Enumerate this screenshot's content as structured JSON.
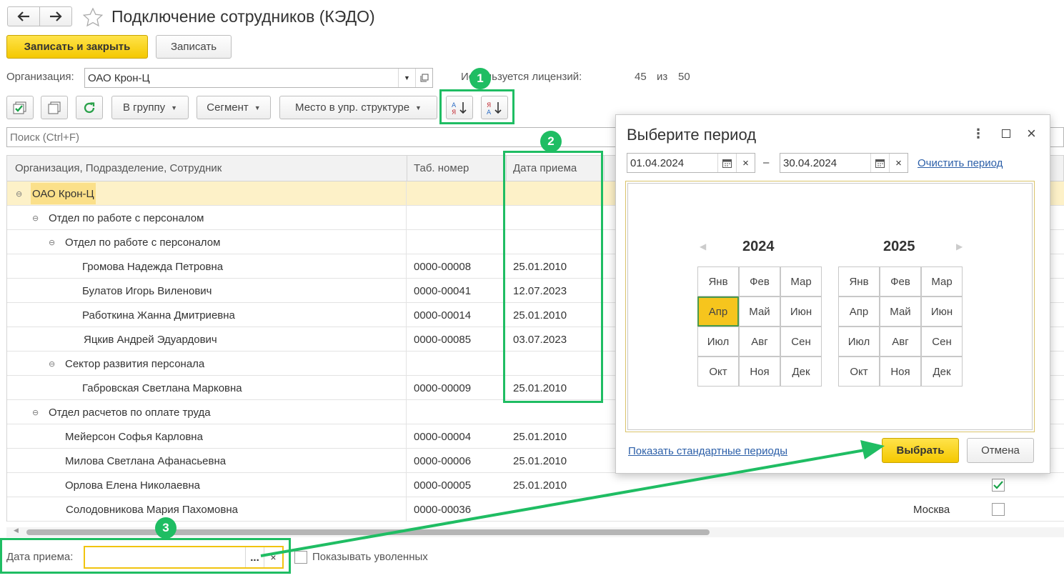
{
  "window": {
    "title": "Подключение сотрудников (КЭДО)"
  },
  "toolbar": {
    "save_close": "Записать и закрыть",
    "save": "Записать"
  },
  "org": {
    "label": "Организация:",
    "value": "ОАО Крон-Ц",
    "licenses_label": "Используется лицензий:",
    "used": "45",
    "of": "из",
    "total": "50"
  },
  "filters": {
    "group": "В группу",
    "segment": "Сегмент",
    "place": "Место в упр. структуре"
  },
  "search": {
    "placeholder": "Поиск (Ctrl+F)"
  },
  "table": {
    "headers": [
      "Организация, Подразделение, Сотрудник",
      "Таб. номер",
      "Дата приема"
    ],
    "rows": [
      {
        "name": "ОАО Крон-Ц",
        "tab": "",
        "date": ""
      },
      {
        "name": "Отдел по работе с персоналом",
        "tab": "",
        "date": ""
      },
      {
        "name": "Отдел по работе с персоналом",
        "tab": "",
        "date": ""
      },
      {
        "name": "Громова Надежда Петровна",
        "tab": "0000-00008",
        "date": "25.01.2010"
      },
      {
        "name": "Булатов Игорь Виленович",
        "tab": "0000-00041",
        "date": "12.07.2023"
      },
      {
        "name": "Работкина Жанна Дмитриевна",
        "tab": "0000-00014",
        "date": "25.01.2010"
      },
      {
        "name": "Яцкив Андрей Эдуардович",
        "tab": "0000-00085",
        "date": "03.07.2023"
      },
      {
        "name": "Сектор развития персонала",
        "tab": "",
        "date": ""
      },
      {
        "name": "Габровская Светлана Марковна",
        "tab": "0000-00009",
        "date": "25.01.2010"
      },
      {
        "name": "Отдел расчетов по оплате труда",
        "tab": "",
        "date": ""
      },
      {
        "name": "Мейерсон Софья Карловна",
        "tab": "0000-00004",
        "date": "25.01.2010"
      },
      {
        "name": "Милова Светлана Афанасьевна",
        "tab": "0000-00006",
        "date": "25.01.2010"
      },
      {
        "name": "Орлова Елена Николаевна",
        "tab": "0000-00005",
        "date": "25.01.2010"
      },
      {
        "name": "Солодовникова Мария Пахомовна",
        "tab": "0000-00036",
        "date": ""
      }
    ],
    "city": "Москва"
  },
  "bottom": {
    "date_label": "Дата приема:",
    "show_fired": "Показывать уволенных",
    "select_btn": "..."
  },
  "dialog": {
    "title": "Выберите период",
    "from": "01.04.2024",
    "dash": "–",
    "to": "30.04.2024",
    "clear": "Очистить период",
    "years": [
      "2024",
      "2025"
    ],
    "months": [
      "Янв",
      "Фев",
      "Мар",
      "Апр",
      "Май",
      "Июн",
      "Июл",
      "Авг",
      "Сен",
      "Окт",
      "Ноя",
      "Дек"
    ],
    "std_periods": "Показать стандартные периоды",
    "ok": "Выбрать",
    "cancel": "Отмена"
  },
  "badges": [
    "1",
    "2",
    "3"
  ],
  "colors": {
    "accent_green": "#1fbd63",
    "yellow": "#f4c800",
    "link": "#2c5fa8"
  }
}
